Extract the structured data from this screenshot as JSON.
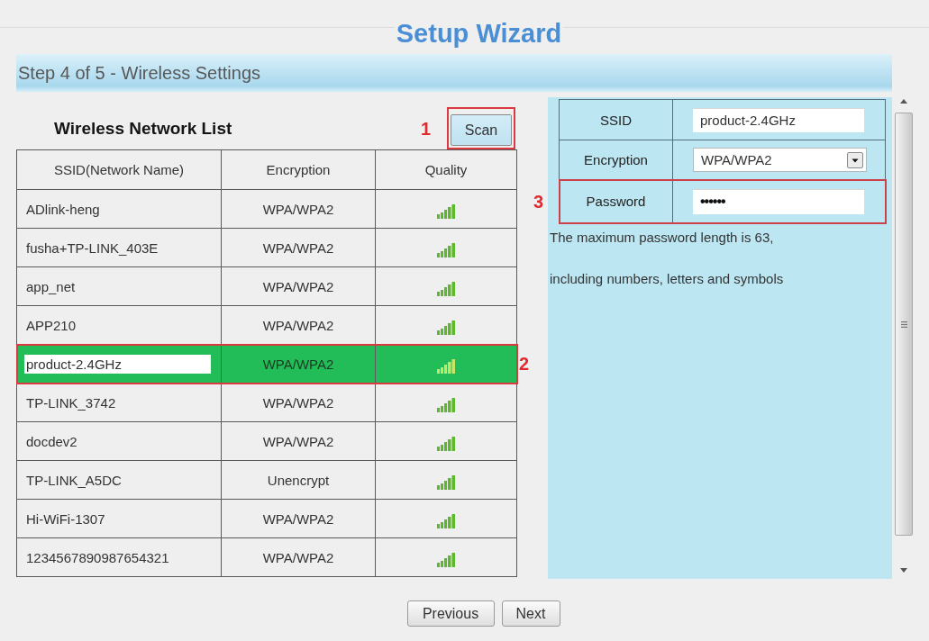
{
  "title": "Setup Wizard",
  "step_bar": {
    "title": "Step 4 of 5 - Wireless Settings"
  },
  "network_list": {
    "title": "Wireless Network List",
    "scan_button": {
      "label": "Scan",
      "callout": "1"
    },
    "columns": [
      "SSID(Network Name)",
      "Encryption",
      "Quality"
    ],
    "rows": [
      {
        "ssid": "ADlink-heng",
        "encryption": "WPA/WPA2",
        "selected": false
      },
      {
        "ssid": "fusha+TP-LINK_403E",
        "encryption": "WPA/WPA2",
        "selected": false
      },
      {
        "ssid": "app_net",
        "encryption": "WPA/WPA2",
        "selected": false
      },
      {
        "ssid": "APP210",
        "encryption": "WPA/WPA2",
        "selected": false
      },
      {
        "ssid": "product-2.4GHz",
        "encryption": "WPA/WPA2",
        "selected": true,
        "callout": "2"
      },
      {
        "ssid": "TP-LINK_3742",
        "encryption": "WPA/WPA2",
        "selected": false
      },
      {
        "ssid": "docdev2",
        "encryption": "WPA/WPA2",
        "selected": false
      },
      {
        "ssid": "TP-LINK_A5DC",
        "encryption": "Unencrypt",
        "selected": false
      },
      {
        "ssid": "Hi-WiFi-1307",
        "encryption": "WPA/WPA2",
        "selected": false
      },
      {
        "ssid": "1234567890987654321",
        "encryption": "WPA/WPA2",
        "selected": false
      }
    ]
  },
  "settings": {
    "fields": [
      {
        "kind": "text",
        "label": "SSID",
        "value": "product-2.4GHz"
      },
      {
        "kind": "select",
        "label": "Encryption",
        "value": "WPA/WPA2"
      },
      {
        "kind": "password",
        "label": "Password",
        "value": "••••••",
        "callout": "3"
      }
    ],
    "hints": [
      "The maximum password length is 63,",
      "including numbers, letters and symbols"
    ]
  },
  "buttons": [
    "Previous",
    "Next"
  ]
}
